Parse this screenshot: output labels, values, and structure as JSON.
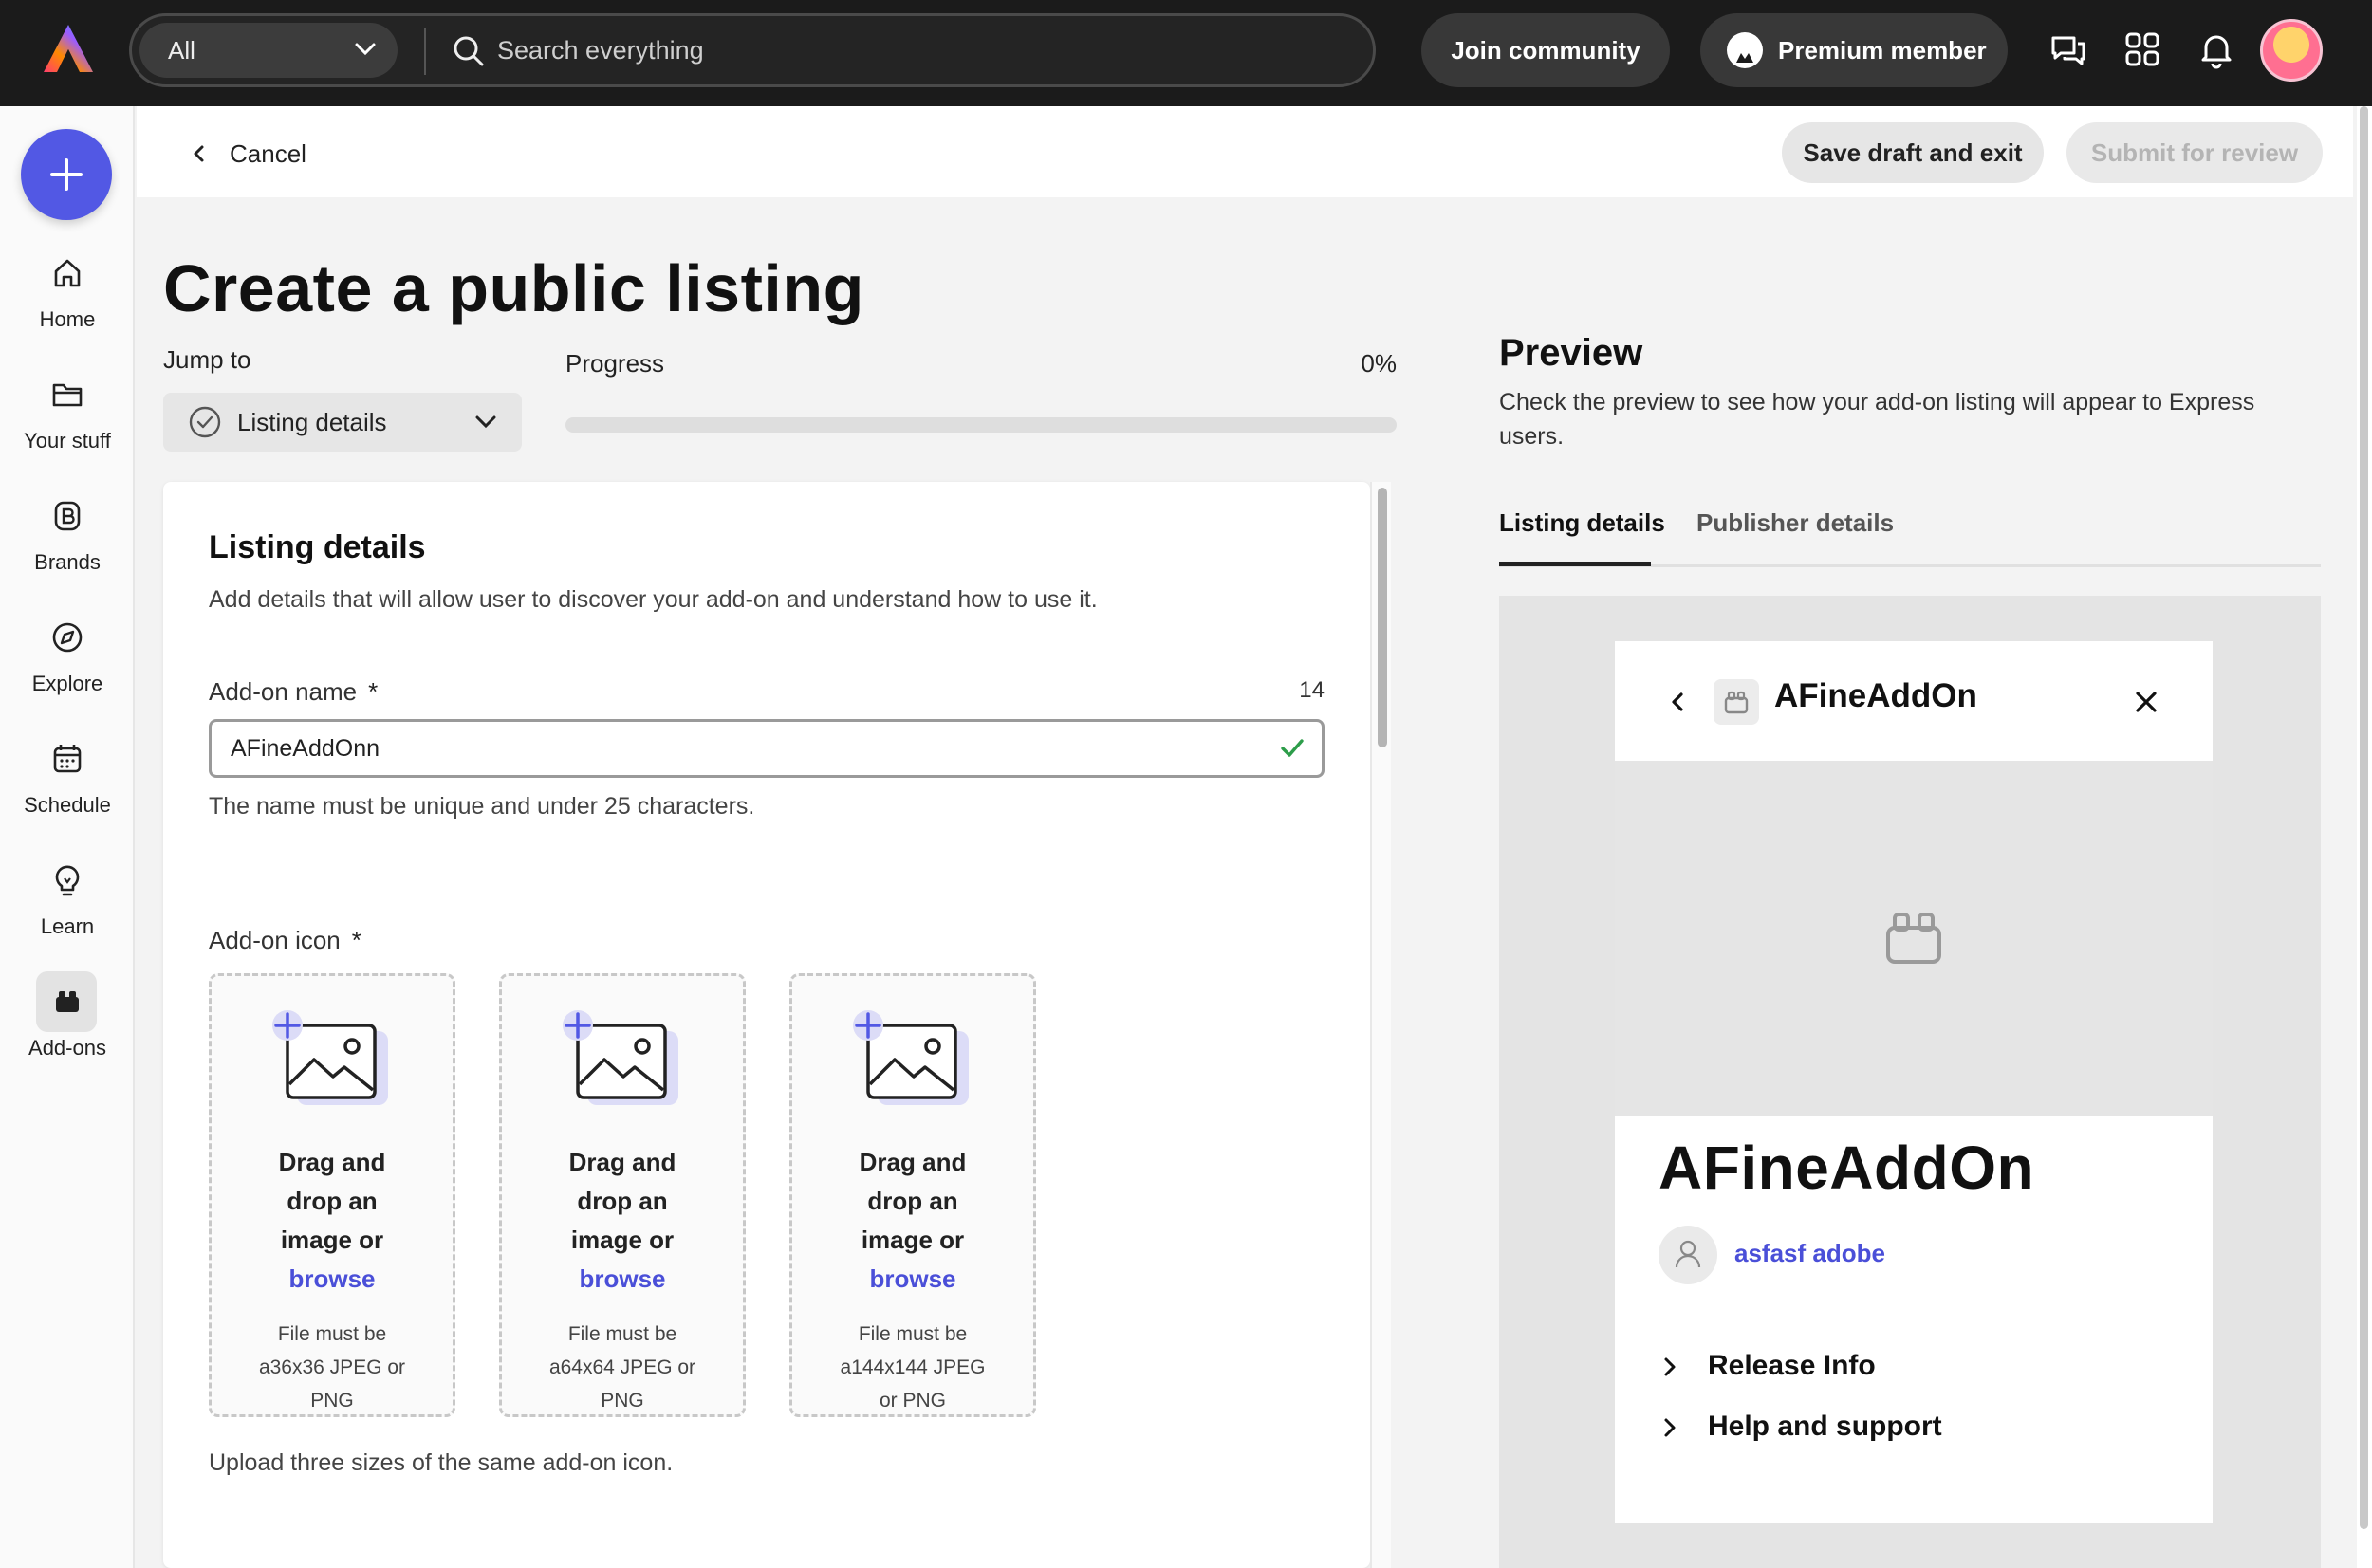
{
  "topbar": {
    "search_scope": "All",
    "search_placeholder": "Search everything",
    "join_label": "Join community",
    "premium_label": "Premium member"
  },
  "rail": {
    "items": [
      {
        "label": "Home",
        "icon": "home-icon"
      },
      {
        "label": "Your stuff",
        "icon": "folder-icon"
      },
      {
        "label": "Brands",
        "icon": "brand-icon"
      },
      {
        "label": "Explore",
        "icon": "compass-icon"
      },
      {
        "label": "Schedule",
        "icon": "calendar-icon"
      },
      {
        "label": "Learn",
        "icon": "lightbulb-icon"
      },
      {
        "label": "Add-ons",
        "icon": "addons-icon"
      }
    ]
  },
  "header": {
    "cancel_label": "Cancel",
    "save_label": "Save draft and exit",
    "submit_label": "Submit for review"
  },
  "page": {
    "title": "Create a public listing",
    "jump_label": "Jump to",
    "jump_value": "Listing details",
    "progress_label": "Progress",
    "progress_value": "0%",
    "progress_fraction": 0
  },
  "form": {
    "section_title": "Listing details",
    "section_desc": "Add details that will allow user to discover your add-on and understand how to use it.",
    "name_label": "Add-on name",
    "required_mark": "*",
    "name_count": "14",
    "name_value": "AFineAddOnn",
    "name_help": "The name must be unique and under 25 characters.",
    "icon_label": "Add-on icon",
    "icon_help": "Upload three sizes of the same add-on icon.",
    "drop_zones": [
      {
        "l1": "Drag and",
        "l2": "drop an",
        "l3": "image or",
        "browse": "browse",
        "r1": "File must be",
        "r2": "a36x36 JPEG or",
        "r3": "PNG"
      },
      {
        "l1": "Drag and",
        "l2": "drop an",
        "l3": "image or",
        "browse": "browse",
        "r1": "File must be",
        "r2": "a64x64 JPEG or",
        "r3": "PNG"
      },
      {
        "l1": "Drag and",
        "l2": "drop an",
        "l3": "image or",
        "browse": "browse",
        "r1": "File must be",
        "r2": "a144x144 JPEG",
        "r3": "or PNG"
      }
    ]
  },
  "preview": {
    "title": "Preview",
    "desc": "Check the preview to see how your add-on listing will appear to Express users.",
    "tabs": [
      "Listing details",
      "Publisher details"
    ],
    "app_name": "AFineAddOn",
    "big_name": "AFineAddOn",
    "author": "asfasf adobe",
    "rows": [
      "Release Info",
      "Help and support"
    ]
  },
  "colors": {
    "accent": "#5258e4",
    "link": "#4a4fd8",
    "success": "#2d9d4a",
    "topbar_bg": "#1b1b1b"
  }
}
